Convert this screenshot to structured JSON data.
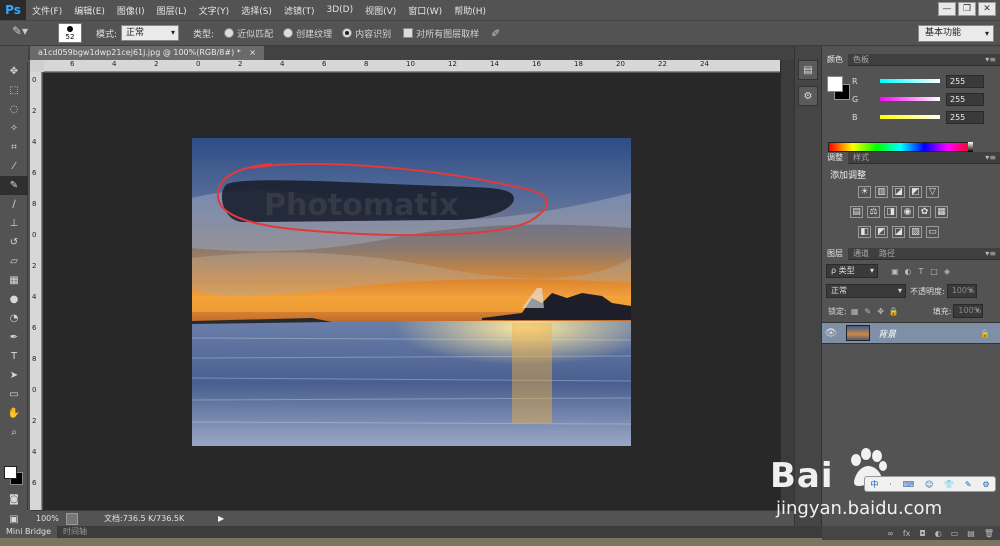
{
  "app": {
    "logo": "Ps",
    "menus": [
      "文件(F)",
      "编辑(E)",
      "图像(I)",
      "图层(L)",
      "文字(Y)",
      "选择(S)",
      "滤镜(T)",
      "3D(D)",
      "视图(V)",
      "窗口(W)",
      "帮助(H)"
    ],
    "window_buttons": [
      "—",
      "❐",
      "✕"
    ]
  },
  "options": {
    "brush_size": "52",
    "mode_label": "模式:",
    "mode_value": "正常",
    "type_label": "类型:",
    "radio_options": [
      "近似匹配",
      "创建纹理",
      "内容识别"
    ],
    "selected_radio": "内容识别",
    "sample_all_label": "对所有图层取样",
    "workspace": "基本功能"
  },
  "document": {
    "tab_title": "a1cd059bgw1dwp21cej61j.jpg @ 100%(RGB/8#) *",
    "tab_close": "×",
    "ruler_top": [
      "6",
      "4",
      "2",
      "0",
      "2",
      "4",
      "6",
      "8",
      "10",
      "12",
      "14",
      "16",
      "18",
      "20",
      "22",
      "24"
    ],
    "ruler_left": [
      "0",
      "2",
      "4",
      "6",
      "8",
      "0",
      "2",
      "4",
      "6",
      "8",
      "0",
      "2",
      "4",
      "6"
    ],
    "watermark_text": "Photomatix"
  },
  "status": {
    "zoom": "100%",
    "doc_info": "文档:736.5 K/736.5K",
    "arrow": "▶"
  },
  "bottom_tabs": [
    "Mini Bridge",
    "时间轴"
  ],
  "color_panel": {
    "tabs": [
      "颜色",
      "色板"
    ],
    "channels": [
      {
        "label": "R",
        "value": "255",
        "color": "#00c8c8"
      },
      {
        "label": "G",
        "value": "255",
        "color": "#d040d0"
      },
      {
        "label": "B",
        "value": "255",
        "color": "#e8e800"
      }
    ]
  },
  "adjustments_panel": {
    "tabs": [
      "调整",
      "样式"
    ],
    "title": "添加调整",
    "row1": [
      "☀",
      "▥",
      "◪",
      "◩",
      "▽"
    ],
    "row2": [
      "▤",
      "⚖",
      "◨",
      "◉",
      "✿",
      "▦"
    ],
    "row3": [
      "◧",
      "◩",
      "◪",
      "▨",
      "▭"
    ]
  },
  "layers_panel": {
    "tabs": [
      "图层",
      "通道",
      "路径"
    ],
    "filter_label": "ρ 类型",
    "filter_icons": [
      "▣",
      "◐",
      "T",
      "□",
      "◈"
    ],
    "blend_mode": "正常",
    "opacity_label": "不透明度:",
    "opacity_value": "100%",
    "lock_label": "锁定:",
    "lock_icons": [
      "▦",
      "✎",
      "✥",
      "🔒"
    ],
    "fill_label": "填充:",
    "fill_value": "100%",
    "layers": [
      {
        "name": "背景",
        "visible_icon": "👁",
        "lock_icon": "🔒"
      }
    ],
    "footer_icons": [
      "∞",
      "fx",
      "◘",
      "◐",
      "▭",
      "▤",
      "🗑"
    ]
  },
  "watermark": {
    "baidu": "Bai",
    "jingyan_domain": "jingyan.baidu.com",
    "ime_items": [
      "中",
      "·",
      "⌨",
      "☺",
      "👕",
      "✎",
      "⚙"
    ]
  }
}
